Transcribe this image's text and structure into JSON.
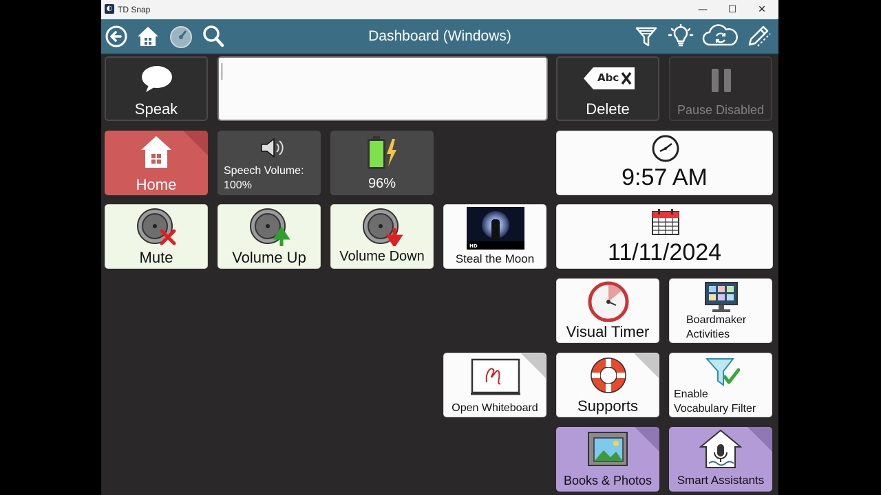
{
  "window": {
    "title": "TD Snap",
    "minimize": "—",
    "maximize": "☐",
    "close": "✕"
  },
  "toolbar": {
    "title": "Dashboard (Windows)",
    "icons": [
      "back-arrow-icon",
      "home-icon",
      "dashboard-gauge-icon",
      "search-icon",
      "vocabulary-filter-icon",
      "lightbulb-icon",
      "sync-cloud-icon",
      "edit-pencil-icon"
    ]
  },
  "message_bar": {
    "speak_label": "Speak",
    "message_text": "",
    "delete_label": "Delete",
    "delete_icon_text": "Abc",
    "pause_label": "Pause Disabled"
  },
  "buttons": {
    "home": "Home",
    "speech_volume_label": "Speech Volume:",
    "speech_volume_value": "100%",
    "battery": "96%",
    "clock_time": "9:57 AM",
    "mute": "Mute",
    "volume_up": "Volume Up",
    "volume_down": "Volume Down",
    "steal_moon": "Steal the Moon",
    "steal_moon_badge": "HD",
    "date": "11/11/2024",
    "visual_timer": "Visual Timer",
    "boardmaker_line1": "Boardmaker",
    "boardmaker_line2": "Activities",
    "open_whiteboard": "Open Whiteboard",
    "supports": "Supports",
    "enable_vocab_line1": "Enable",
    "enable_vocab_line2": "Vocabulary Filter",
    "books_photos": "Books & Photos",
    "smart_assistants": "Smart Assistants"
  },
  "colors": {
    "toolbar": "#3b6e84",
    "background": "#2a2828",
    "green_button": "#f0f7e6",
    "purple_button": "#b29bd6",
    "home_button": "#cf5a5a",
    "fold_corner": "#c8c8c8"
  }
}
